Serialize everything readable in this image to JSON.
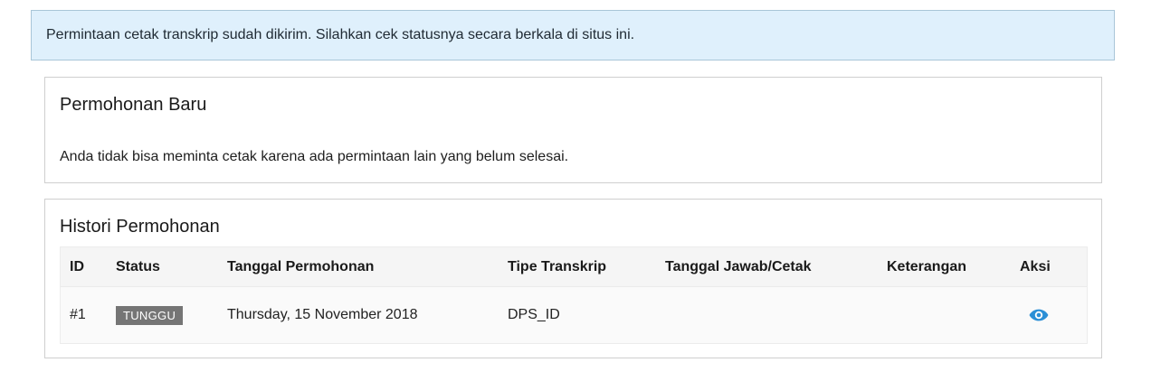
{
  "alert": {
    "message": "Permintaan cetak transkrip sudah dikirim. Silahkan cek statusnya secara berkala di situs ini."
  },
  "new_request": {
    "title": "Permohonan Baru",
    "message": "Anda tidak bisa meminta cetak karena ada permintaan lain yang belum selesai."
  },
  "history": {
    "title": "Histori Permohonan",
    "columns": {
      "id": "ID",
      "status": "Status",
      "request_date": "Tanggal Permohonan",
      "transcript_type": "Tipe Transkrip",
      "reply_date": "Tanggal Jawab/Cetak",
      "notes": "Keterangan",
      "action": "Aksi"
    },
    "rows": [
      {
        "id": "#1",
        "status": "TUNGGU",
        "request_date": "Thursday, 15 November 2018",
        "transcript_type": "DPS_ID",
        "reply_date": "",
        "notes": "",
        "action_icon": "eye-icon"
      }
    ]
  },
  "colors": {
    "alert_bg": "#dff0fc",
    "badge_bg": "#757575",
    "eye_icon": "#2b8fd6"
  }
}
